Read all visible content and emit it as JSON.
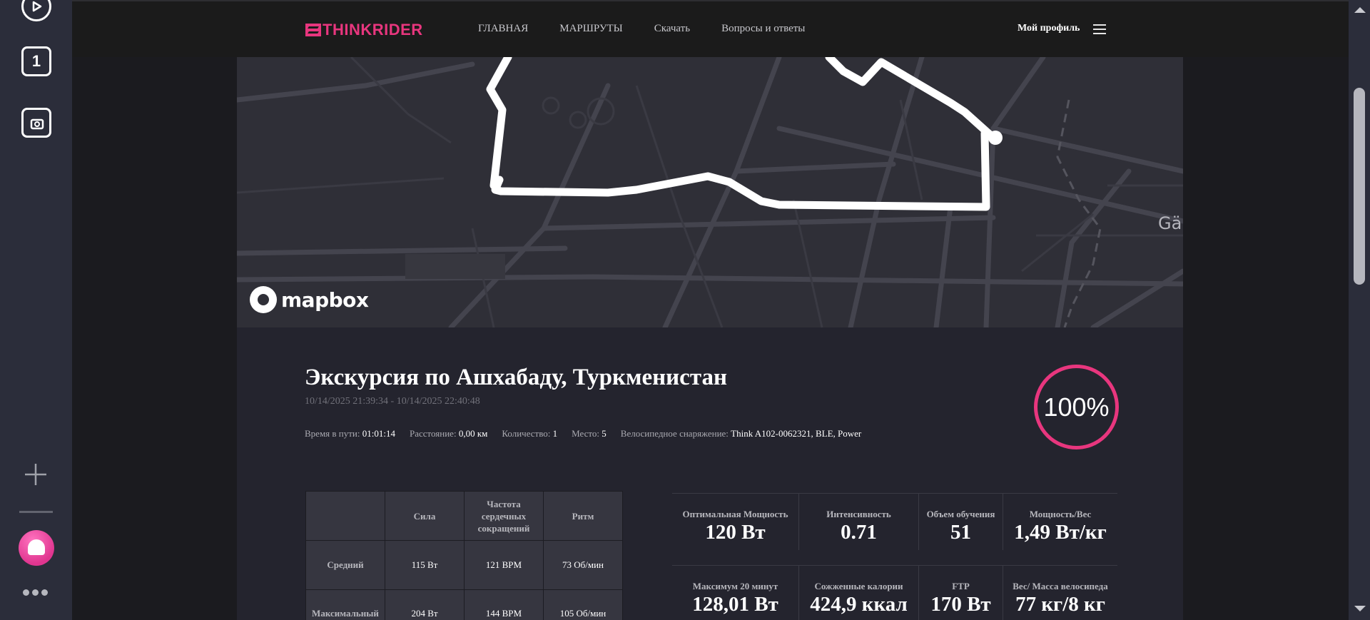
{
  "sidebar": {
    "buttons": [
      {
        "name": "play-icon",
        "label": ""
      },
      {
        "name": "tab-count",
        "label": "1"
      },
      {
        "name": "screenshot-icon",
        "label": ""
      }
    ]
  },
  "header": {
    "logo": "THINKRIDER",
    "nav": [
      "ГЛАВНАЯ",
      "МАРШРУТЫ",
      "Скачать",
      "Вопросы и ответы"
    ],
    "profile": "Мой профиль"
  },
  "map": {
    "attribution": "mapbox",
    "place_label": "Gämi",
    "route_color": "#ffffff"
  },
  "ride": {
    "title": "Экскурсия по Ашхабаду, Туркменистан",
    "dates": "10/14/2025 21:39:34 - 10/14/2025 22:40:48",
    "completion": "100%",
    "meta": [
      {
        "label": "Время в пути:",
        "value": "01:01:14"
      },
      {
        "label": "Расстояние:",
        "value": "0,00 км"
      },
      {
        "label": "Количество:",
        "value": "1"
      },
      {
        "label": "Место:",
        "value": "5"
      },
      {
        "label": "Велосипедное снаряжение:",
        "value": "Think A102-0062321, BLE, Power"
      }
    ]
  },
  "stats_table": {
    "headers": [
      "",
      "Сила",
      "Частота сердечных сокращений",
      "Ритм"
    ],
    "rows": [
      {
        "label": "Средний",
        "values": [
          "115 Вт",
          "121 BPM",
          "73 Об/мин"
        ]
      },
      {
        "label": "Максимальный",
        "values": [
          "204 Вт",
          "144 BPM",
          "105 Об/мин"
        ]
      }
    ]
  },
  "metrics": [
    [
      {
        "label": "Оптимальная Мощность",
        "value": "120 Вт"
      },
      {
        "label": "Интенсивность",
        "value": "0.71"
      },
      {
        "label": "Объем обучения",
        "value": "51"
      },
      {
        "label": "Мощность/Вес",
        "value": "1,49 Вт/кг"
      }
    ],
    [
      {
        "label": "Максимум 20 минут",
        "value": "128,01 Вт"
      },
      {
        "label": "Сожженные калории",
        "value": "424,9 ккал"
      },
      {
        "label": "FTP",
        "value": "170 Вт"
      },
      {
        "label": "Вес/ Масса велосипеда",
        "value": "77 кг/8 кг"
      }
    ]
  ],
  "colors": {
    "accent": "#e8367e",
    "page_bg": "#1b1b1f",
    "panel_bg": "#24242e"
  }
}
